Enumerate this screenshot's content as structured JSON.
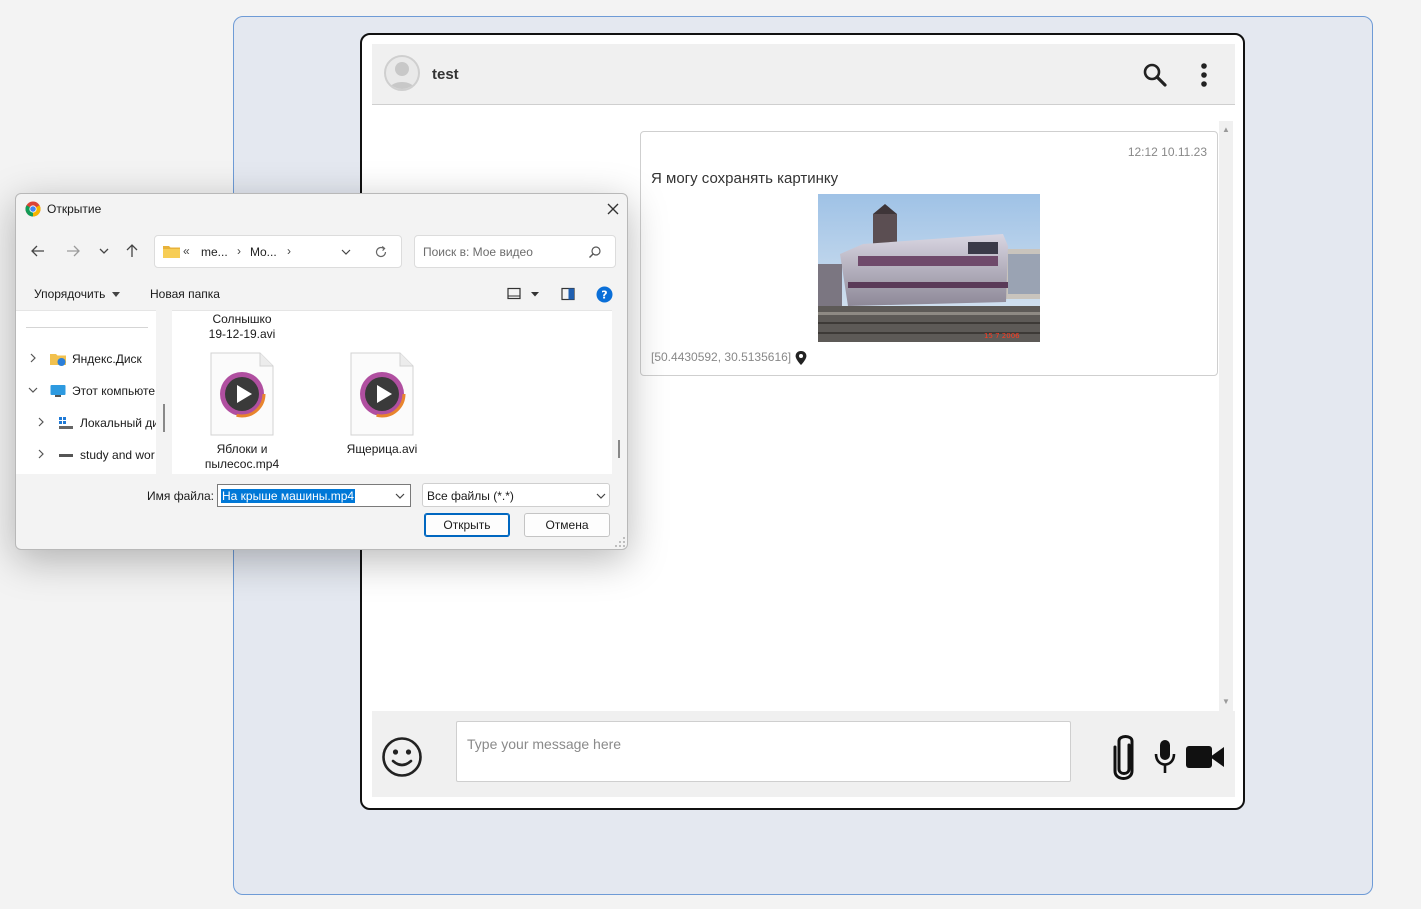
{
  "chat": {
    "contact_name": "test",
    "message": {
      "time": "12:12 10.11.23",
      "text": "Я могу сохранять картинку",
      "coords": "[50.4430592, 30.5135616]",
      "image_stamp": "15  7 2006"
    },
    "composer": {
      "placeholder": "Type your message here"
    },
    "icons": [
      "avatar-icon",
      "search-icon",
      "more-vert-icon",
      "location-pin-icon",
      "emoji-icon",
      "paperclip-icon",
      "microphone-icon",
      "video-camera-icon"
    ]
  },
  "dialog": {
    "title": "Открытие",
    "address": {
      "prefix": "«",
      "crumb1": "me...",
      "sep1": "›",
      "crumb2": "Mo...",
      "sep2": "›"
    },
    "search_placeholder": "Поиск в: Мое видео",
    "toolbar": {
      "organize": "Упорядочить",
      "new_folder": "Новая папка"
    },
    "nav_items": [
      {
        "label": "Яндекс.Диск"
      },
      {
        "label": "Этот компьюте"
      },
      {
        "label": "Локальный ди"
      },
      {
        "label": "study and wor"
      }
    ],
    "files": [
      {
        "name": "Солнышко 19-12-19.avi",
        "line1": "Солнышко",
        "line2": "19-12-19.avi"
      },
      {
        "name": "Яблоки и пылесос.mp4",
        "line1": "Яблоки и",
        "line2": "пылесос.mp4"
      },
      {
        "name": "Ящерица.avi",
        "line1": "Ящерица.avi",
        "line2": ""
      }
    ],
    "filename_label": "Имя файла:",
    "filename_value": "На крыше машины.mp4",
    "filetype_value": "Все файлы (*.*)",
    "open_label": "Открыть",
    "cancel_label": "Отмена"
  },
  "colors": {
    "app_frame_bg": "#e4e8f0",
    "app_frame_border": "#6e9bd6",
    "selection": "#0078d7",
    "help_blue": "#0a6fd8"
  }
}
